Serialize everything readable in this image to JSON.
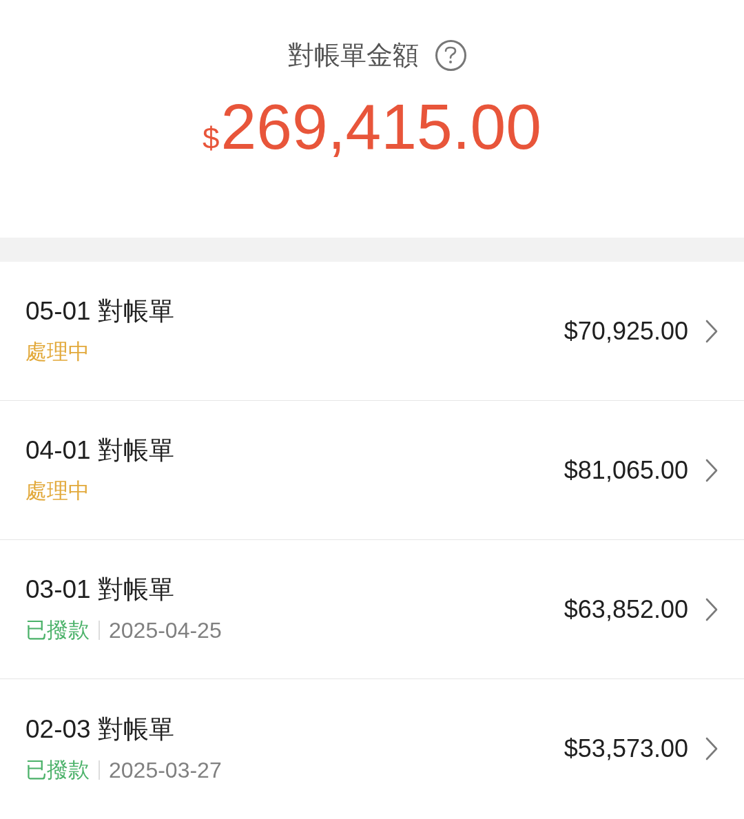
{
  "header": {
    "title": "對帳單金額",
    "currency": "$",
    "amount": "269,415.00"
  },
  "statements": [
    {
      "title": "05-01 對帳單",
      "status": {
        "kind": "processing",
        "label": "處理中"
      },
      "amount": "$70,925.00"
    },
    {
      "title": "04-01 對帳單",
      "status": {
        "kind": "processing",
        "label": "處理中"
      },
      "amount": "$81,065.00"
    },
    {
      "title": "03-01 對帳單",
      "status": {
        "kind": "paid",
        "label": "已撥款",
        "date": "2025-04-25"
      },
      "amount": "$63,852.00"
    },
    {
      "title": "02-03 對帳單",
      "status": {
        "kind": "paid",
        "label": "已撥款",
        "date": "2025-03-27"
      },
      "amount": "$53,573.00"
    }
  ]
}
